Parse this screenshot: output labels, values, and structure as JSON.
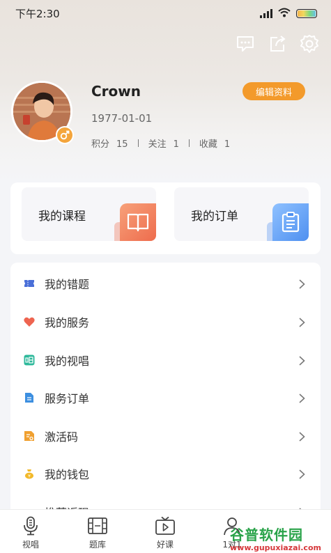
{
  "status_bar": {
    "time": "下午2:30"
  },
  "profile": {
    "name": "Crown",
    "edit_label": "编辑资料",
    "birthday": "1977-01-01",
    "stats": [
      {
        "label": "积分",
        "value": "15"
      },
      {
        "label": "关注",
        "value": "1"
      },
      {
        "label": "收藏",
        "value": "1"
      }
    ]
  },
  "quick": {
    "courses": "我的课程",
    "orders": "我的订单"
  },
  "menu": [
    {
      "label": "我的错题",
      "icon": "ticket-icon",
      "color": "#4a6fd8"
    },
    {
      "label": "我的服务",
      "icon": "heart-icon",
      "color": "#ee6450"
    },
    {
      "label": "我的视唱",
      "icon": "sing-icon",
      "color": "#2cb89a"
    },
    {
      "label": "服务订单",
      "icon": "document-icon",
      "color": "#3d8fe0"
    },
    {
      "label": "激活码",
      "icon": "code-icon",
      "color": "#f0a030"
    },
    {
      "label": "我的钱包",
      "icon": "wallet-icon",
      "color": "#f2b92a"
    },
    {
      "label": "推荐返现",
      "icon": "gift-icon",
      "color": "#a36be0"
    }
  ],
  "tabs": [
    {
      "label": "视唱",
      "icon": "microphone-icon"
    },
    {
      "label": "题库",
      "icon": "film-icon"
    },
    {
      "label": "好课",
      "icon": "tv-play-icon"
    },
    {
      "label": "1对1",
      "icon": "person-icon"
    }
  ],
  "watermark": {
    "text": "谷普软件园",
    "url": "www.gupuxiazai.com"
  }
}
